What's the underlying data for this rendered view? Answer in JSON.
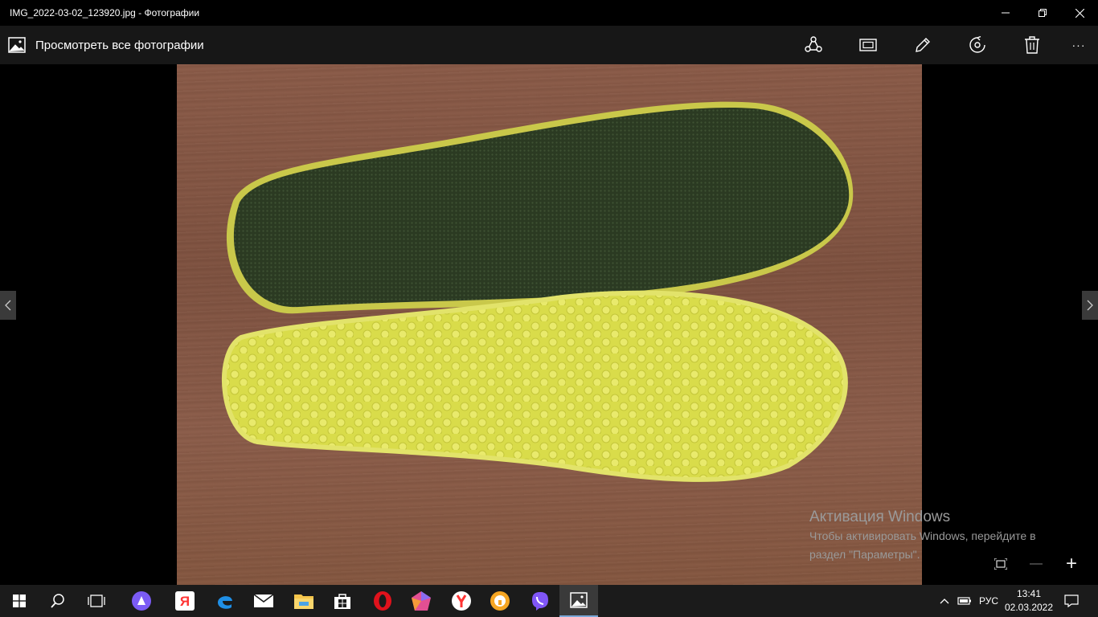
{
  "window": {
    "title": "IMG_2022-03-02_123920.jpg - Фотографии",
    "controls": [
      "minimize-icon",
      "restore-icon",
      "close-icon"
    ]
  },
  "appbar": {
    "back_label": "Просмотреть все фотографии",
    "tools": [
      "share-icon",
      "slideshow-icon",
      "edit-icon",
      "rotate-icon",
      "delete-icon",
      "more-icon"
    ],
    "more_label": "···"
  },
  "activation": {
    "heading": "Активация Windows",
    "line1": "Чтобы активировать Windows, перейдите в",
    "line2": "раздел \"Параметры\"."
  },
  "zoom": {
    "minus": "—",
    "plus": "+"
  },
  "taskbar": {
    "apps": [
      "start-icon",
      "search-icon",
      "task-view-icon",
      "alice-icon",
      "yandex-icon",
      "edge-icon",
      "mail-icon",
      "file-explorer-icon",
      "store-icon",
      "opera-icon",
      "kristal-icon",
      "yandex-browser-icon",
      "vpn-icon",
      "viber-icon",
      "photos-icon"
    ],
    "language": "РУС",
    "time": "13:41",
    "date": "02.03.2022"
  }
}
